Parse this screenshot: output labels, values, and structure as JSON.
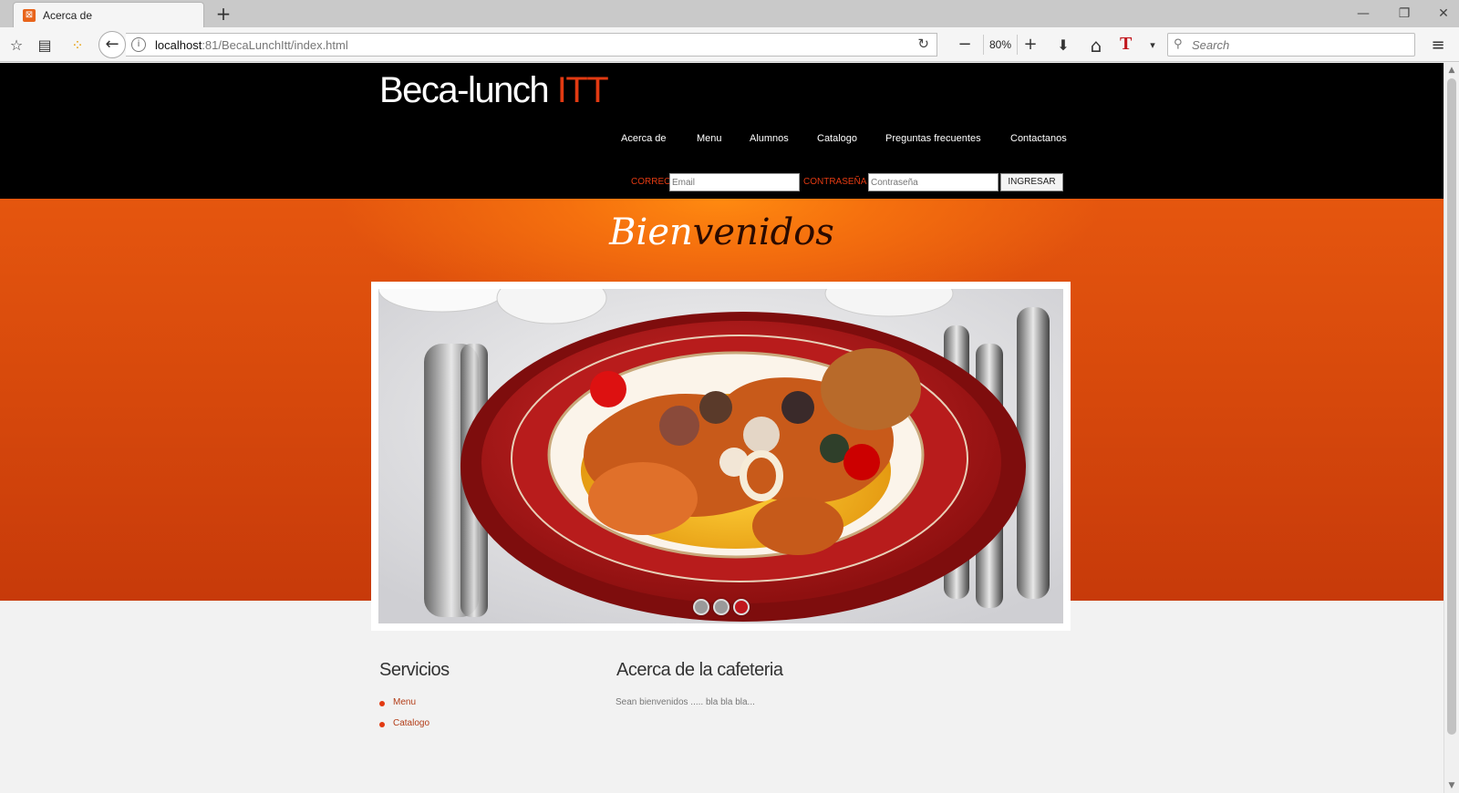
{
  "browser": {
    "tab_title": "Acerca de",
    "favicon_glyph": "⊠",
    "new_tab_glyph": "+",
    "url_host": "localhost",
    "url_rest": ":81/BecaLunchItt/index.html",
    "zoom": "80%",
    "search_placeholder": "Search",
    "icons": {
      "bookmark": "☆",
      "reader": "▤",
      "apps": "⁘",
      "back": "←",
      "info": "i",
      "reload": "↻",
      "zoom_out": "−",
      "zoom_in": "+",
      "download": "⬇",
      "home": "⌂",
      "t_ext": "T",
      "dropdown": "▾",
      "search": "⚲",
      "menu": "≡",
      "minimize": "—",
      "restore": "❐",
      "close": "✕",
      "scroll_up": "▲",
      "scroll_down": "▼"
    }
  },
  "site": {
    "logo_main": "Beca-lunch ",
    "logo_accent": "ITT",
    "nav": [
      "Acerca de",
      "Menu",
      "Alumnos",
      "Catalogo",
      "Preguntas frecuentes",
      "Contactanos"
    ],
    "login": {
      "email_label": "CORREO",
      "email_placeholder": "Email",
      "password_label": "CONTRASEÑA",
      "password_placeholder": "Contraseña",
      "submit": "INGRESAR"
    },
    "hero_title_light": "Bien",
    "hero_title_dark": "venidos",
    "slider_active_index": 2,
    "colors": {
      "accent": "#e23a12",
      "hero": "#d9490c",
      "header": "#000000"
    }
  },
  "footer": {
    "services_title": "Servicios",
    "services": [
      "Menu",
      "Catalogo"
    ],
    "about_title": "Acerca de la cafeteria",
    "about_text": "Sean bienvenidos ..... bla bla bla..."
  }
}
